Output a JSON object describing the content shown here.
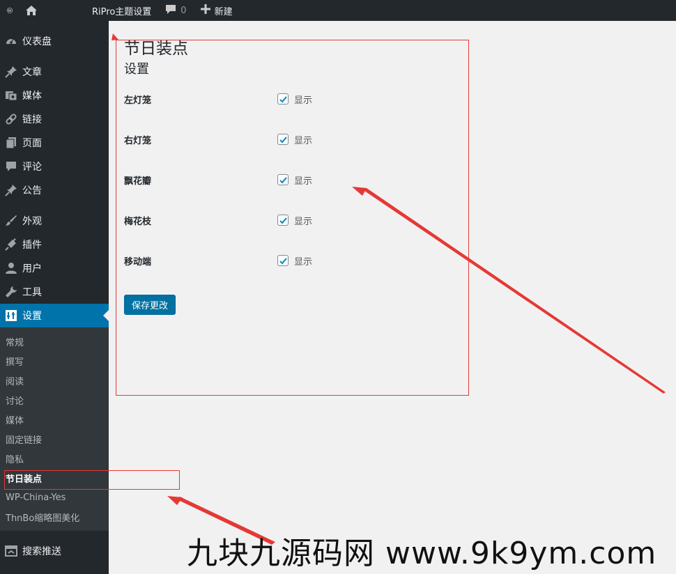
{
  "adminbar": {
    "site_name": "RiPro主题设置",
    "comments_count": "0",
    "new_label": "新建"
  },
  "sidebar": {
    "items_top": [
      {
        "label": "仪表盘",
        "icon": "dashboard-icon"
      }
    ],
    "items_content": [
      {
        "label": "文章",
        "icon": "pin-icon"
      },
      {
        "label": "媒体",
        "icon": "media-icon"
      },
      {
        "label": "链接",
        "icon": "link-icon"
      },
      {
        "label": "页面",
        "icon": "page-icon"
      },
      {
        "label": "评论",
        "icon": "comment-icon"
      },
      {
        "label": "公告",
        "icon": "pin-icon"
      }
    ],
    "items_admin": [
      {
        "label": "外观",
        "icon": "brush-icon"
      },
      {
        "label": "插件",
        "icon": "plugin-icon"
      },
      {
        "label": "用户",
        "icon": "user-icon"
      },
      {
        "label": "工具",
        "icon": "wrench-icon"
      },
      {
        "label": "设置",
        "icon": "settings-icon"
      }
    ],
    "submenu": [
      "常规",
      "撰写",
      "阅读",
      "讨论",
      "媒体",
      "固定链接",
      "隐私",
      "节日装点",
      "WP-China-Yes",
      "ThnBo缩略图美化"
    ],
    "submenu_current": "节日装点",
    "items_bottom": [
      {
        "label": "搜索推送",
        "icon": "push-icon"
      }
    ]
  },
  "main": {
    "page_title": "节日装点",
    "section_title": "设置",
    "rows": [
      {
        "label": "左灯笼",
        "checkbox_label": "显示",
        "checked": true
      },
      {
        "label": "右灯笼",
        "checkbox_label": "显示",
        "checked": true
      },
      {
        "label": "飘花瓣",
        "checkbox_label": "显示",
        "checked": true
      },
      {
        "label": "梅花枝",
        "checkbox_label": "显示",
        "checked": true
      },
      {
        "label": "移动端",
        "checkbox_label": "显示",
        "checked": true
      }
    ],
    "save_label": "保存更改"
  },
  "watermark": "九块九源码网 www.9k9ym.com",
  "colors": {
    "adminbar_bg": "#23282d",
    "sidebar_bg": "#23282d",
    "submenu_bg": "#32373c",
    "accent": "#0073aa",
    "annotation": "#e53935"
  }
}
